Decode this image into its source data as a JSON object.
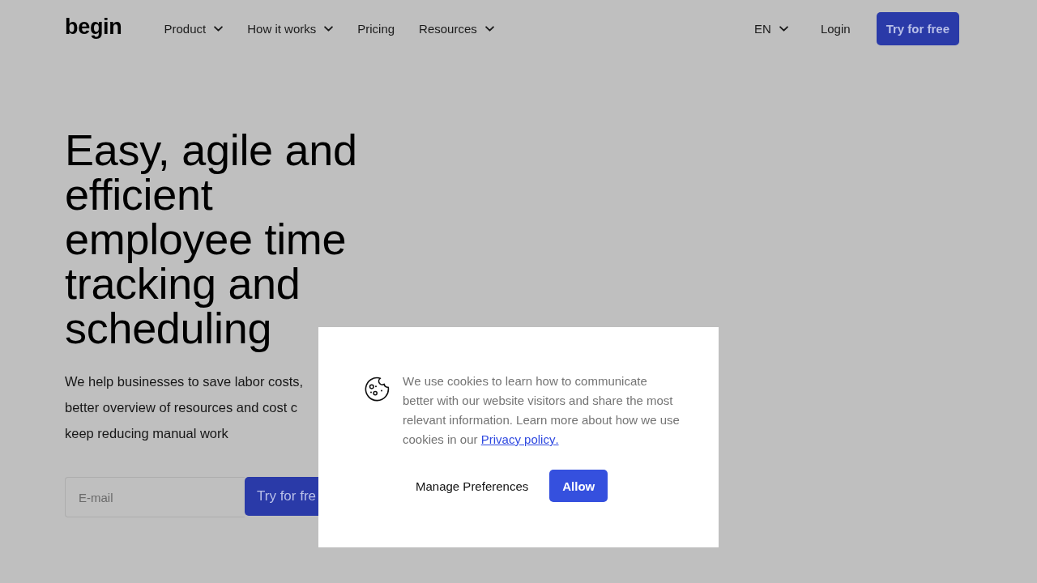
{
  "header": {
    "logo": "begin",
    "nav": [
      {
        "label": "Product",
        "has_dropdown": true
      },
      {
        "label": "How it works",
        "has_dropdown": true
      },
      {
        "label": "Pricing",
        "has_dropdown": false
      },
      {
        "label": "Resources",
        "has_dropdown": true
      }
    ],
    "language": {
      "label": "EN",
      "has_dropdown": true
    },
    "login": "Login",
    "cta": "Try for free"
  },
  "hero": {
    "title": "Easy, agile and efficient employee time tracking and scheduling",
    "subtitle_lines": [
      "We help businesses to save labor costs,",
      "better overview of resources and cost c",
      "keep reducing manual work"
    ],
    "email": {
      "placeholder": "E-mail"
    },
    "button": "Try for fre"
  },
  "cookie_dialog": {
    "message": "We use cookies to learn how to communicate better with our website visitors and share the most relevant information. Learn more about how we use cookies in our",
    "link": "Privacy policy.",
    "buttons": [
      {
        "label": "Manage Preferences",
        "kind": "text"
      },
      {
        "label": "Allow",
        "kind": "primary"
      }
    ]
  }
}
